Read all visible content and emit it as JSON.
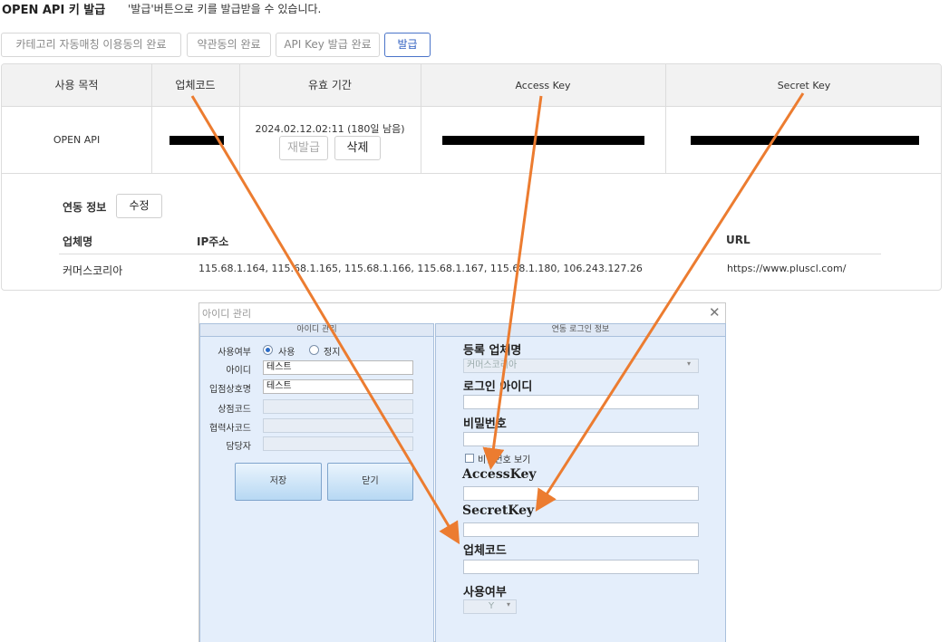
{
  "header": {
    "title": "OPEN API 키 발급",
    "description": "'발급'버튼으로 키를 발급받을 수 있습니다."
  },
  "steps": {
    "category": "카테고리 자동매칭 이용동의 완료",
    "terms": "약관동의 완료",
    "apikey": "API Key 발급 완료",
    "issue": "발급"
  },
  "table": {
    "headers": [
      "사용 목적",
      "업체코드",
      "유효 기간",
      "Access Key",
      "Secret Key"
    ],
    "row": {
      "purpose": "OPEN API",
      "validity": "2024.02.12.02:11 (180일 남음)",
      "reissue": "재발급",
      "delete": "삭제"
    }
  },
  "integration": {
    "label": "연동 정보",
    "edit": "수정",
    "col_company": "업체명",
    "col_ip": "IP주소",
    "col_url": "URL",
    "company": "커머스코리아",
    "ips": "115.68.1.164, 115.68.1.165, 115.68.1.166, 115.68.1.167, 115.68.1.180, 106.243.127.26",
    "url": "https://www.pluscl.com/"
  },
  "dialog": {
    "title": "아이디 관리",
    "close": "✕",
    "left": {
      "heading": "아이디 관리",
      "use_label": "사용여부",
      "opt_use": "사용",
      "opt_stop": "정지",
      "id_label": "아이디",
      "id_value": "테스트",
      "shop_label": "입점상호명",
      "shop_value": "테스트",
      "store_code_label": "상점코드",
      "partner_code_label": "협력사코드",
      "manager_label": "담당자",
      "save": "저장",
      "close": "닫기"
    },
    "right": {
      "heading": "연동 로그인 정보",
      "company_label": "등록 업체명",
      "company_value": "커머스코리아",
      "login_label": "로그인 아이디",
      "password_label": "비밀번호",
      "show_password": "비밀번호 보기",
      "access_label": "AccessKey",
      "secret_label": "SecretKey",
      "code_label": "업체코드",
      "use_label": "사용여부",
      "use_value": "Y"
    }
  },
  "colors": {
    "accent": "#2f5fc0",
    "arrow": "#ec7c30",
    "pane_bg": "#e4eefb"
  }
}
